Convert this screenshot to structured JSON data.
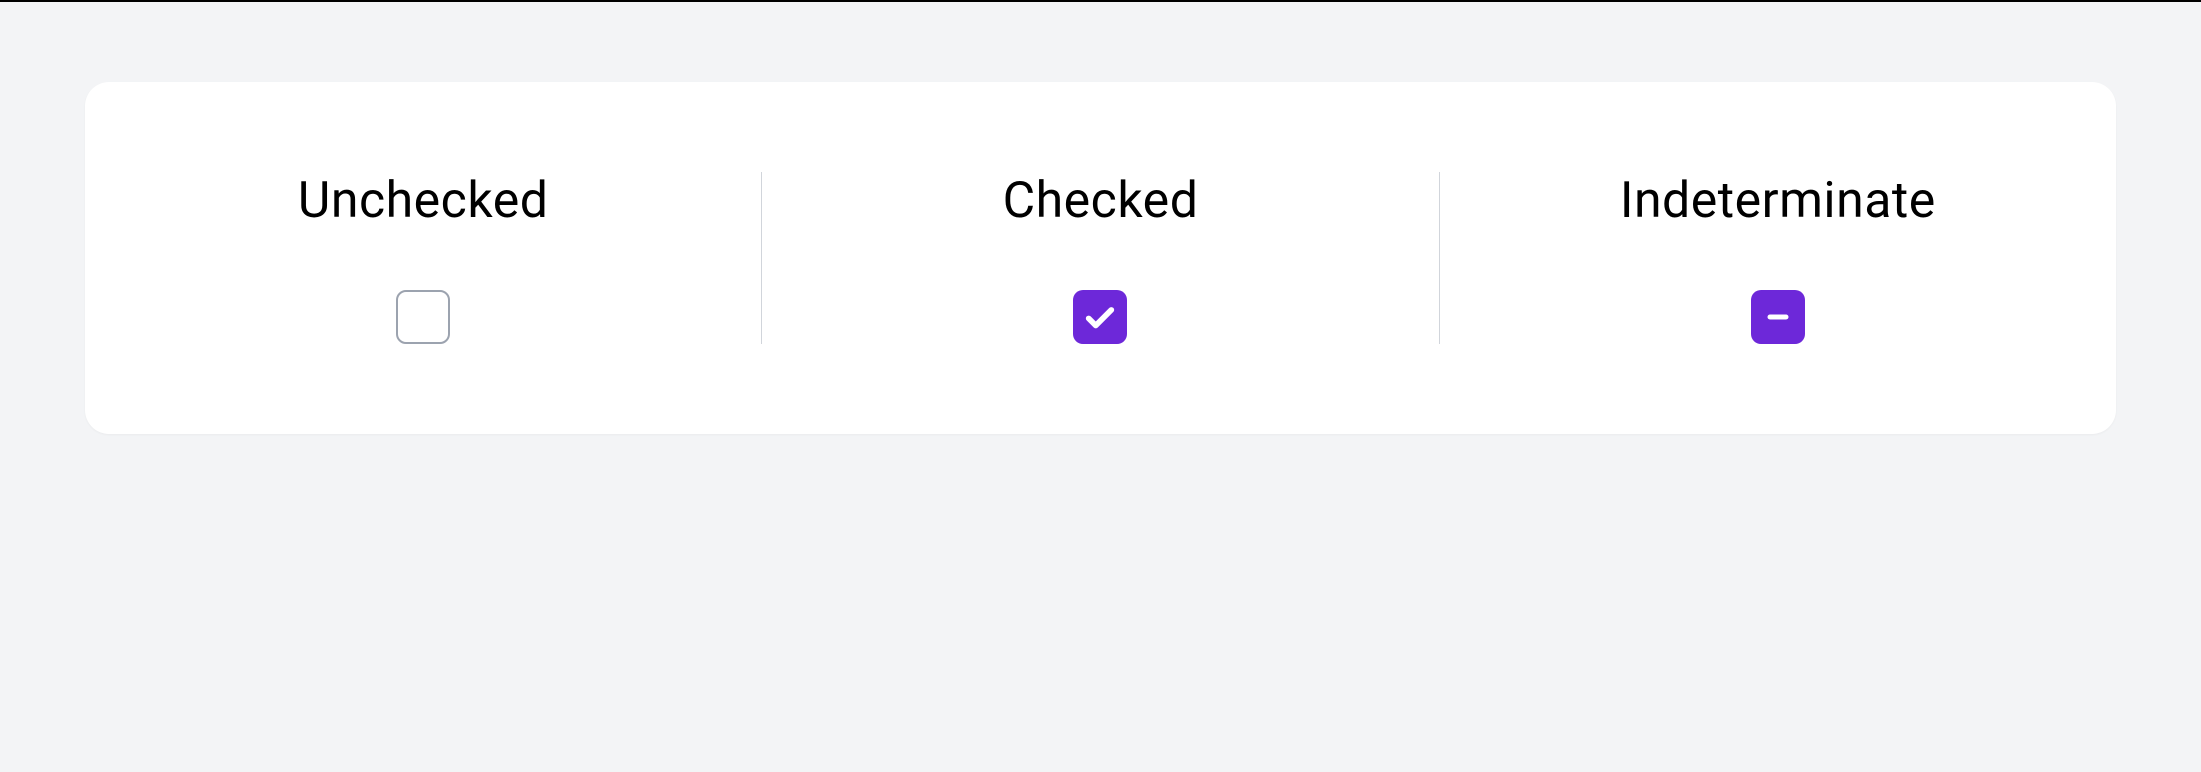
{
  "checkboxStates": {
    "unchecked": {
      "label": "Unchecked"
    },
    "checked": {
      "label": "Checked"
    },
    "indeterminate": {
      "label": "Indeterminate"
    }
  },
  "colors": {
    "accent": "#6d28d9",
    "border": "#9ca3af",
    "background": "#f3f4f6",
    "card": "#ffffff"
  }
}
